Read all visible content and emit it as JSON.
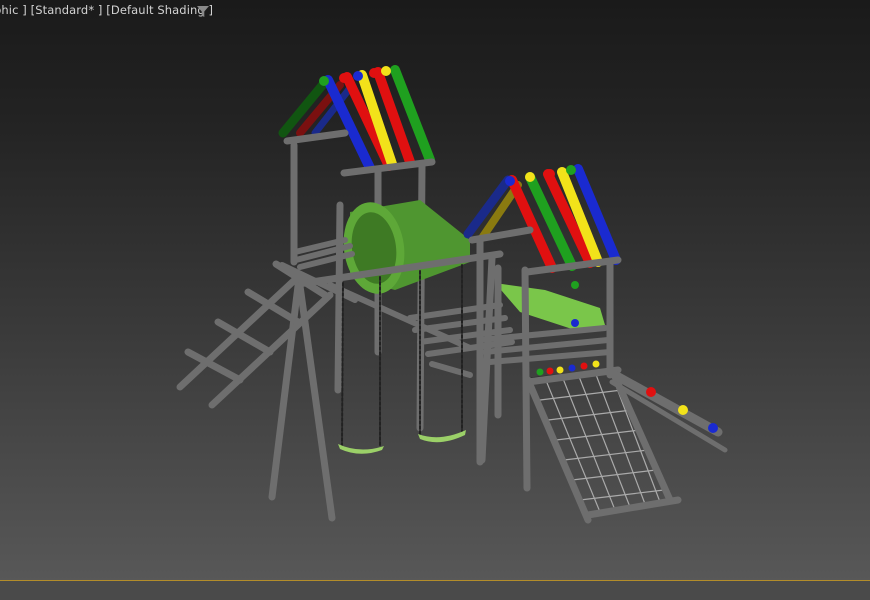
{
  "viewport": {
    "label_parts": [
      "phic ]",
      "[Standard* ]",
      "[Default Shading ]"
    ],
    "filter_icon": "funnel-icon"
  },
  "colors": {
    "pole": "#6e6e6e",
    "pole_dark": "#3a3a3a",
    "roof_red": "#e01010",
    "roof_yellow": "#f2e21a",
    "roof_green": "#1fa01f",
    "roof_blue": "#1a2ad0",
    "tunnel": "#5ea838",
    "slide": "#7ac64a",
    "swing_seat": "#9bd068",
    "selection_line": "#b38d2a"
  }
}
